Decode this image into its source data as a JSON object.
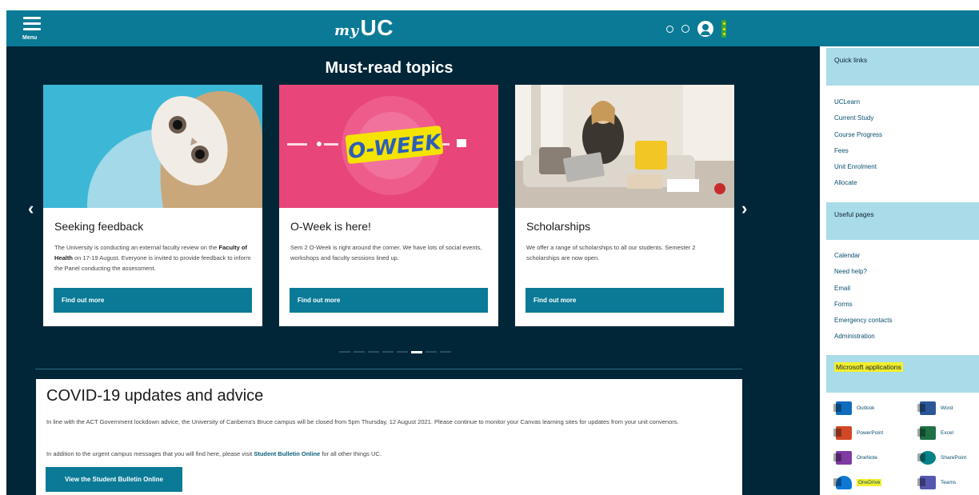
{
  "header": {
    "menu_label": "Menu",
    "logo_my": "my",
    "logo_uc": "UC",
    "kebab_color": "#3aa63a",
    "brand_color": "#0a7a96"
  },
  "topics": {
    "title": "Must-read topics",
    "prev_arrow": "‹",
    "next_arrow": "›",
    "cards": [
      {
        "title": "Seeking feedback",
        "text_pre": "The University is conducting an external faculty review on the ",
        "text_bold": "Faculty of Health",
        "text_post": " on 17-19 August. Everyone is invited to provide feedback to inform the Panel conducting the assessment.",
        "button": "Find out more"
      },
      {
        "title": "O-Week is here!",
        "text": "Sem 2 O-Week is right around the corner. We have lots of social events, workshops and faculty sessions lined up.",
        "button": "Find out more",
        "banner_text": "O-WEEK"
      },
      {
        "title": "Scholarships",
        "text": "We offer a range of scholarships to all our students. Semester 2 scholarships are now open.",
        "button": "Find out more"
      }
    ]
  },
  "covid": {
    "title": "COVID-19 updates and advice",
    "p1": "In line with the ACT Government lockdown advice, the University of Canberra's Bruce campus will be closed from 5pm Thursday, 12 August 2021. Please continue to monitor your Canvas learning sites for updates from your unit convenors.",
    "p2_pre": "In addition to the urgent campus messages that you will find here, please visit ",
    "p2_link": "Student Bulletin Online",
    "p2_post": " for all other things UC.",
    "button": "View the Student Bulletin Online"
  },
  "sidebar": {
    "quick_links": {
      "title": "Quick links",
      "items": [
        "UCLearn",
        "Current Study",
        "Course Progress",
        "Fees",
        "Unit Enrolment",
        "Allocate"
      ]
    },
    "useful_pages": {
      "title": "Useful pages",
      "items": [
        "Calendar",
        "Need help?",
        "Email",
        "Forms",
        "Emergency contacts",
        "Administration"
      ]
    },
    "microsoft": {
      "title": "Microsoft applications",
      "apps": [
        {
          "name": "Outlook",
          "color": "#0f6cbd"
        },
        {
          "name": "Word",
          "color": "#2b5797"
        },
        {
          "name": "PowerPoint",
          "color": "#d24726"
        },
        {
          "name": "Excel",
          "color": "#1e7145"
        },
        {
          "name": "OneNote",
          "color": "#7e3ba0"
        },
        {
          "name": "SharePoint",
          "color": "#038387"
        },
        {
          "name": "OneDrive",
          "color": "#0f78d4"
        },
        {
          "name": "Teams",
          "color": "#5558af"
        }
      ]
    }
  }
}
